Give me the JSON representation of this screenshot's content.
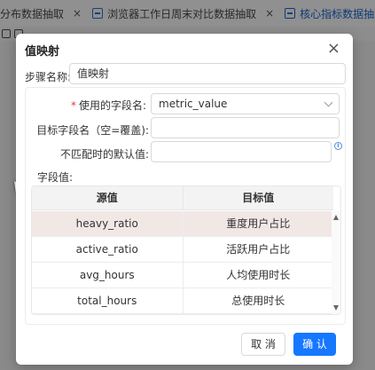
{
  "background": {
    "tabs": [
      {
        "label": "分布数据抽取",
        "active": false
      },
      {
        "label": "浏览器工作日周末对比数据抽取",
        "active": false
      },
      {
        "label": "核心指标数据抽取",
        "active": true
      }
    ],
    "close_glyph": "×"
  },
  "dialog": {
    "title": "值映射",
    "close_glyph": "×",
    "step_name_label": "步骤名称:",
    "step_name_value": "值映射",
    "source_field_label": "使用的字段名:",
    "source_field_value": "metric_value",
    "target_field_label": "目标字段名（空=覆盖):",
    "target_field_value": "",
    "default_value_label": "不匹配时的默认值:",
    "default_value_value": "",
    "info_glyph": "i",
    "field_values_label": "字段值:",
    "table": {
      "columns": [
        "源值",
        "目标值"
      ],
      "rows": [
        {
          "source": "heavy_ratio",
          "target": "重度用户占比",
          "selected": true
        },
        {
          "source": "active_ratio",
          "target": "活跃用户占比",
          "selected": false
        },
        {
          "source": "avg_hours",
          "target": "人均使用时长",
          "selected": false
        },
        {
          "source": "total_hours",
          "target": "总使用时长",
          "selected": false
        }
      ]
    },
    "cancel_label": "取 消",
    "ok_label": "确 认"
  },
  "colors": {
    "primary": "#1677ff",
    "required": "#e53935",
    "selected_row": "#f1e8e6"
  }
}
